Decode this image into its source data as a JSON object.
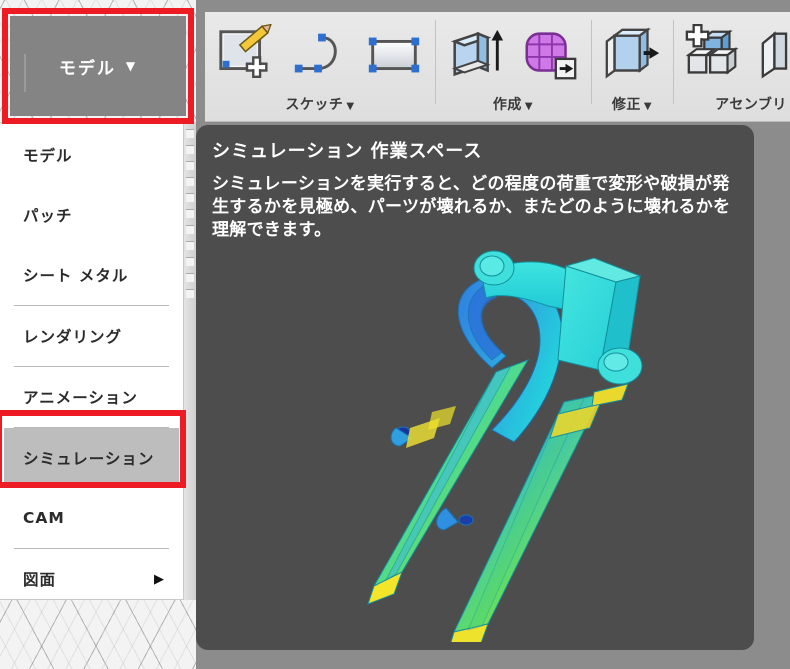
{
  "workspace_button": {
    "label": "モデル",
    "caret": "▼",
    "icon": "chevron-down-icon"
  },
  "ribbon": {
    "groups": [
      {
        "label": "スケッチ",
        "caret": "▼",
        "icons": [
          "create-sketch-icon",
          "line-spline-icon",
          "rectangle-icon"
        ]
      },
      {
        "label": "作成",
        "caret": "▼",
        "icons": [
          "extrude-icon",
          "create-form-icon"
        ]
      },
      {
        "label": "修正",
        "caret": "▼",
        "icons": [
          "press-pull-icon"
        ]
      },
      {
        "label": "アセンブリ",
        "caret": "",
        "icons": [
          "new-component-icon",
          "joint-icon"
        ]
      }
    ]
  },
  "menu": {
    "items": [
      {
        "label": "モデル",
        "selected": false,
        "separator_above": false,
        "submenu": false
      },
      {
        "label": "パッチ",
        "selected": false,
        "separator_above": false,
        "submenu": false
      },
      {
        "label": "シート メタル",
        "selected": false,
        "separator_above": false,
        "submenu": false
      },
      {
        "label": "レンダリング",
        "selected": false,
        "separator_above": true,
        "submenu": false
      },
      {
        "label": "アニメーション",
        "selected": false,
        "separator_above": true,
        "submenu": false
      },
      {
        "label": "シミュレーション",
        "selected": true,
        "separator_above": true,
        "submenu": false
      },
      {
        "label": "CAM",
        "selected": false,
        "separator_above": false,
        "submenu": false
      },
      {
        "label": "図面",
        "selected": false,
        "separator_above": true,
        "submenu": true,
        "submenu_arrow": "▶"
      }
    ]
  },
  "tooltip": {
    "title": "シミュレーション 作業スペース",
    "body": "シミュレーションを実行すると、どの程度の荷重で変形や破損が発生するかを見極め、パーツが壊れるか、またどのように壊れるかを理解できます。",
    "figure": "bicycle-fork-fea-result"
  },
  "colors": {
    "highlight_red": "#ed1c24",
    "tooltip_bg": "#4d4d4d",
    "workspace_button_bg": "#848484",
    "menu_selected_bg": "#bdbdbd",
    "canvas_gray": "#8c8c8c",
    "stress_low": "#00e0ff",
    "stress_mid": "#2f7fe0",
    "stress_high": "#78e03c",
    "stress_max": "#f2e52a"
  },
  "highlights": [
    {
      "name": "workspace-button-highlight",
      "target": "モデル"
    },
    {
      "name": "simulation-menu-item-highlight",
      "target": "シミュレーション"
    }
  ]
}
